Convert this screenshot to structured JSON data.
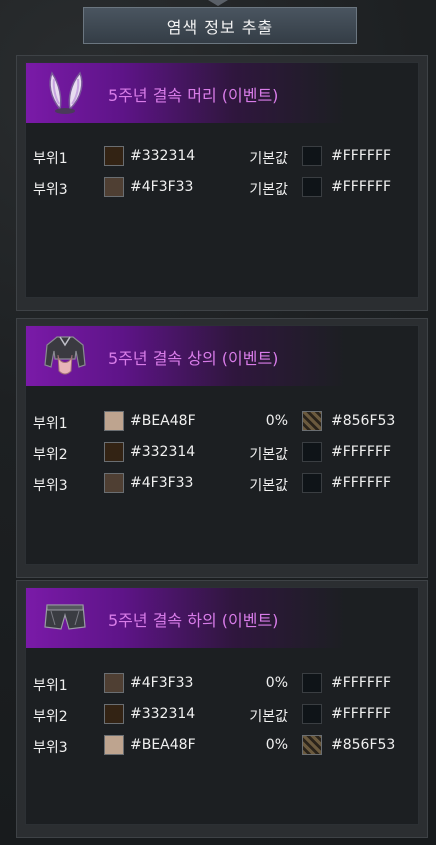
{
  "header": {
    "title": "염색 정보 추출"
  },
  "panels": [
    {
      "title": "5주년 결속 머리 (이벤트)",
      "icon": "rabbit-ears-icon",
      "rows": [
        {
          "label": "부위1",
          "color": "#332314",
          "option": "기본값",
          "color2": "#FFFFFF",
          "pattern": false
        },
        {
          "label": "부위3",
          "color": "#4F3F33",
          "option": "기본값",
          "color2": "#FFFFFF",
          "pattern": false
        }
      ]
    },
    {
      "title": "5주년 결속 상의 (이벤트)",
      "icon": "top-garment-icon",
      "rows": [
        {
          "label": "부위1",
          "color": "#BEA48F",
          "option": "0%",
          "color2": "#856F53",
          "pattern": true
        },
        {
          "label": "부위2",
          "color": "#332314",
          "option": "기본값",
          "color2": "#FFFFFF",
          "pattern": false
        },
        {
          "label": "부위3",
          "color": "#4F3F33",
          "option": "기본값",
          "color2": "#FFFFFF",
          "pattern": false
        }
      ]
    },
    {
      "title": "5주년 결속 하의 (이벤트)",
      "icon": "shorts-icon",
      "rows": [
        {
          "label": "부위1",
          "color": "#4F3F33",
          "option": "0%",
          "color2": "#FFFFFF",
          "pattern": false
        },
        {
          "label": "부위2",
          "color": "#332314",
          "option": "기본값",
          "color2": "#FFFFFF",
          "pattern": false
        },
        {
          "label": "부위3",
          "color": "#BEA48F",
          "option": "0%",
          "color2": "#856F53",
          "pattern": true
        }
      ]
    }
  ]
}
